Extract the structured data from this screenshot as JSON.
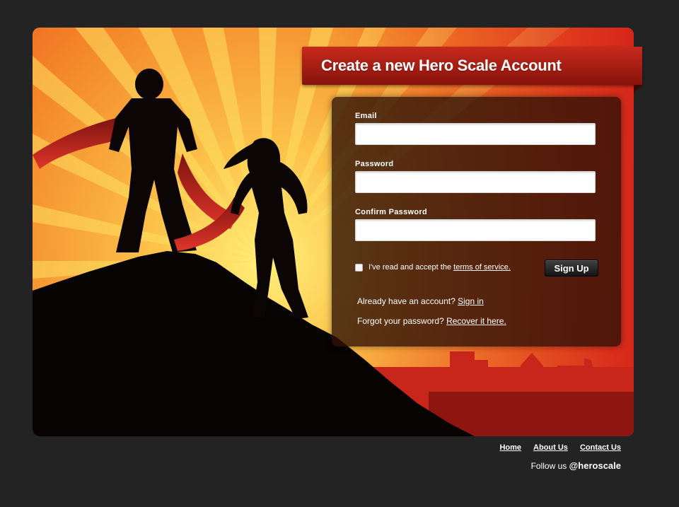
{
  "page": {
    "title": "Create a new Hero Scale Account"
  },
  "form": {
    "email_label": "Email",
    "email_value": "",
    "password_label": "Password",
    "password_value": "",
    "confirm_label": "Confirm Password",
    "confirm_value": "",
    "terms_text": "I've read and accept the",
    "terms_link": "terms of service.",
    "terms_checked": false,
    "signup_label": "Sign Up",
    "signin_text": "Already have an account?",
    "signin_link": "Sign in",
    "recover_text": "Forgot your password?",
    "recover_link": "Recover it here."
  },
  "footer": {
    "nav": [
      "Home",
      "About Us",
      "Contact Us"
    ],
    "follow_text": "Follow us",
    "handle_at": "@",
    "handle": "heroscale"
  },
  "colors": {
    "background": "#232323",
    "ribbon_red": "#b42015",
    "panel": "#30120680",
    "sunburst_orange": "#f4902a",
    "sunburst_yellow": "#fde060",
    "city_red": "#c8261b"
  },
  "icons": {
    "hero": "superhero-silhouette-illustration",
    "heroine": "superheroine-silhouette-illustration",
    "city": "city-skyline-silhouette"
  }
}
